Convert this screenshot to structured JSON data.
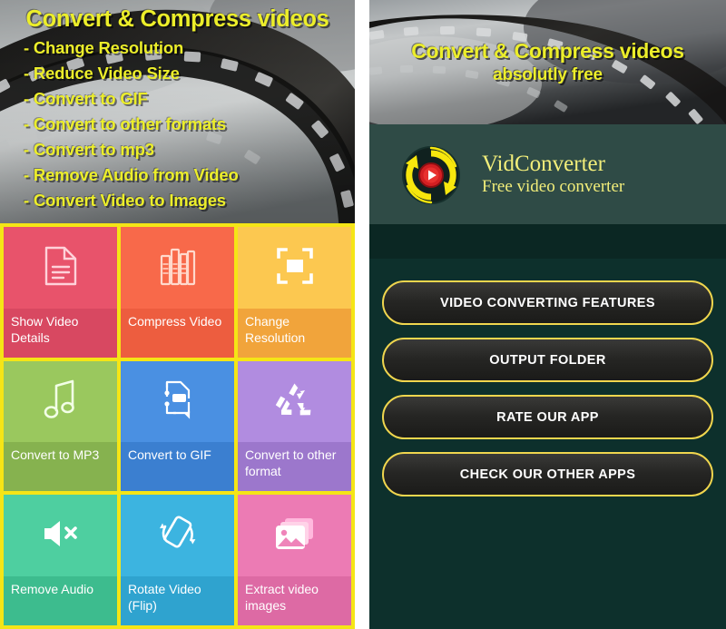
{
  "left_screen": {
    "banner": {
      "title": "Convert & Compress videos",
      "features": [
        "- Change Resolution",
        "- Reduce Video Size",
        "- Convert to GIF",
        "- Convert to other formats",
        "- Convert to mp3",
        "- Remove Audio from Video",
        "- Convert Video to Images"
      ]
    },
    "grid_border_color": "#f5e516",
    "tiles": [
      {
        "label": "Show Video Details",
        "icon": "document-icon",
        "color": "#e8536b",
        "label_color": "#d84861"
      },
      {
        "label": "Compress Video",
        "icon": "books-icon",
        "color": "#f8694a",
        "label_color": "#ed5d3f"
      },
      {
        "label": "Change Resolution",
        "icon": "crop-resize-icon",
        "color": "#fcc850",
        "label_color": "#f1a43b"
      },
      {
        "label": "Convert to MP3",
        "icon": "music-note-icon",
        "color": "#9ac85e",
        "label_color": "#86b24f"
      },
      {
        "label": "Convert to GIF",
        "icon": "file-convert-icon",
        "color": "#4a90e2",
        "label_color": "#3b7fd0"
      },
      {
        "label": "Convert to other format",
        "icon": "recycle-icon",
        "color": "#b18ce0",
        "label_color": "#9c77cc"
      },
      {
        "label": "Remove Audio",
        "icon": "mute-speaker-icon",
        "color": "#4ecfa0",
        "label_color": "#3dbc8e"
      },
      {
        "label": "Rotate Video (Flip)",
        "icon": "rotate-device-icon",
        "color": "#3cb4e0",
        "label_color": "#2fa3cf"
      },
      {
        "label": "Extract video images",
        "icon": "photos-icon",
        "color": "#ec7bb4",
        "label_color": "#dd6aa4"
      }
    ]
  },
  "right_screen": {
    "banner": {
      "title": "Convert & Compress videos",
      "subtitle": "absolutly free"
    },
    "logo": {
      "icon": "vidconverter-logo-icon",
      "name": "VidConverter",
      "tagline": "Free video converter",
      "accent_color": "#f2ee7a"
    },
    "buttons": [
      "VIDEO CONVERTING FEATURES",
      "OUTPUT FOLDER",
      "RATE OUR APP",
      "CHECK OUR OTHER APPS"
    ],
    "button_border_color": "#f0d64e",
    "background_color": "#0d302c"
  }
}
